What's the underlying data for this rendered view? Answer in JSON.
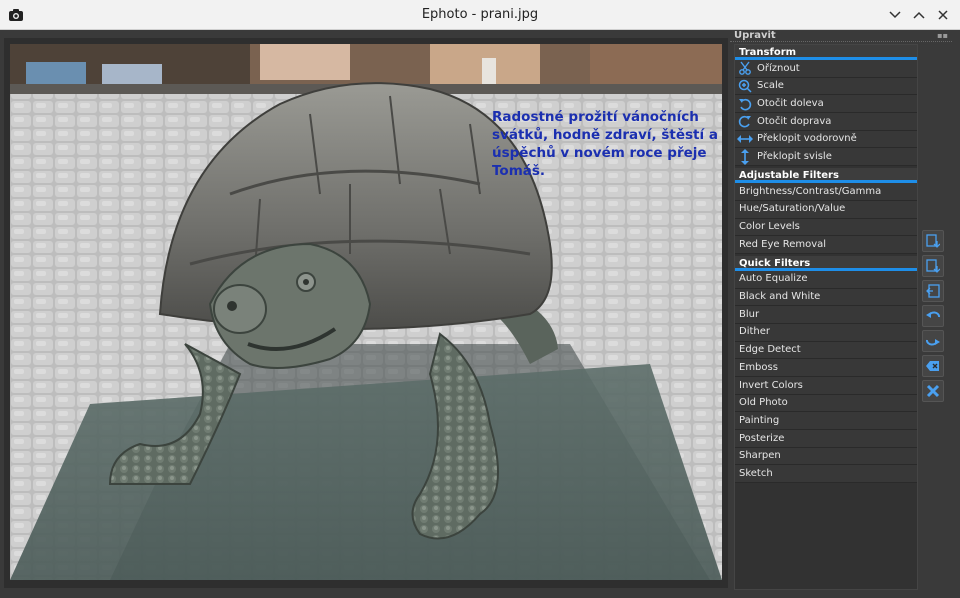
{
  "window": {
    "title": "Ephoto - prani.jpg"
  },
  "photo": {
    "greeting_text": "Radostné prožití vánočních svátků, hodně zdraví, štěstí a úspěchů v novém roce přeje Tomáš."
  },
  "panel": {
    "title": "Upravit",
    "sections": {
      "transform": {
        "label": "Transform",
        "items": [
          "Oříznout",
          "Scale",
          "Otočit doleva",
          "Otočit doprava",
          "Překlopit vodorovně",
          "Překlopit svisle"
        ]
      },
      "adjustable": {
        "label": "Adjustable Filters",
        "items": [
          "Brightness/Contrast/Gamma",
          "Hue/Saturation/Value",
          "Color Levels",
          "Red Eye Removal"
        ]
      },
      "quick": {
        "label": "Quick Filters",
        "items": [
          "Auto Equalize",
          "Black and White",
          "Blur",
          "Dither",
          "Edge Detect",
          "Emboss",
          "Invert Colors",
          "Old Photo",
          "Painting",
          "Posterize",
          "Sharpen",
          "Sketch"
        ]
      }
    }
  },
  "colors": {
    "accent": "#1e8ee8",
    "greeting": "#1b2fb0"
  },
  "icons": {
    "transform": [
      "scissors-icon",
      "zoom-icon",
      "rotate-left-icon",
      "rotate-right-icon",
      "flip-horizontal-icon",
      "flip-vertical-icon"
    ],
    "toolbar": [
      "import-icon",
      "export-icon",
      "panel-icon",
      "undo-icon",
      "redo-icon",
      "clear-icon",
      "close-icon"
    ]
  }
}
